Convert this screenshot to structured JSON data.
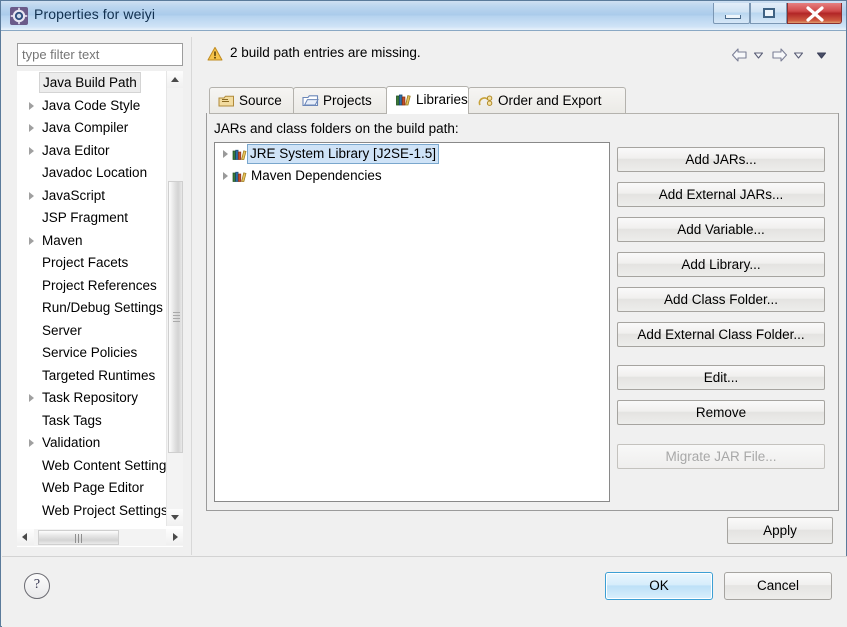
{
  "window": {
    "title": "Properties for weiyi",
    "icon": "eclipse-properties-icon",
    "controls": {
      "minimize": "minimize-button",
      "maximize": "maximize-button",
      "close": "close-button"
    }
  },
  "sidebar": {
    "filter": {
      "placeholder": "type filter text",
      "value": ""
    },
    "items": [
      {
        "label": "Java Build Path",
        "expandable": false,
        "selected": true
      },
      {
        "label": "Java Code Style",
        "expandable": true,
        "selected": false
      },
      {
        "label": "Java Compiler",
        "expandable": true,
        "selected": false
      },
      {
        "label": "Java Editor",
        "expandable": true,
        "selected": false
      },
      {
        "label": "Javadoc Location",
        "expandable": false,
        "selected": false
      },
      {
        "label": "JavaScript",
        "expandable": true,
        "selected": false
      },
      {
        "label": "JSP Fragment",
        "expandable": false,
        "selected": false
      },
      {
        "label": "Maven",
        "expandable": true,
        "selected": false
      },
      {
        "label": "Project Facets",
        "expandable": false,
        "selected": false
      },
      {
        "label": "Project References",
        "expandable": false,
        "selected": false
      },
      {
        "label": "Run/Debug Settings",
        "expandable": false,
        "selected": false
      },
      {
        "label": "Server",
        "expandable": false,
        "selected": false
      },
      {
        "label": "Service Policies",
        "expandable": false,
        "selected": false
      },
      {
        "label": "Targeted Runtimes",
        "expandable": false,
        "selected": false
      },
      {
        "label": "Task Repository",
        "expandable": true,
        "selected": false
      },
      {
        "label": "Task Tags",
        "expandable": false,
        "selected": false
      },
      {
        "label": "Validation",
        "expandable": true,
        "selected": false
      },
      {
        "label": "Web Content Settings",
        "expandable": false,
        "selected": false
      },
      {
        "label": "Web Page Editor",
        "expandable": false,
        "selected": false
      },
      {
        "label": "Web Project Settings",
        "expandable": false,
        "selected": false
      }
    ]
  },
  "status": {
    "icon": "warning-icon",
    "message": "2 build path entries are missing."
  },
  "nav": {
    "back": "back-arrow-icon",
    "back_menu": "back-dropdown-icon",
    "forward": "forward-arrow-icon",
    "forward_menu": "forward-dropdown-icon",
    "menu": "view-menu-icon"
  },
  "tabs": [
    {
      "label": "Source",
      "icon": "source-folder-icon",
      "active": false
    },
    {
      "label": "Projects",
      "icon": "projects-folder-icon",
      "active": false
    },
    {
      "label": "Libraries",
      "icon": "libraries-books-icon",
      "active": true
    },
    {
      "label": "Order and Export",
      "icon": "order-export-icon",
      "active": false
    }
  ],
  "main": {
    "list_label": "JARs and class folders on the build path:",
    "entries": [
      {
        "label": "JRE System Library [J2SE-1.5]",
        "icon": "library-books-icon",
        "selected": true,
        "expandable": true
      },
      {
        "label": "Maven Dependencies",
        "icon": "library-books-icon",
        "selected": false,
        "expandable": true
      }
    ],
    "side_buttons": [
      {
        "label": "Add JARs...",
        "enabled": true
      },
      {
        "label": "Add External JARs...",
        "enabled": true
      },
      {
        "label": "Add Variable...",
        "enabled": true
      },
      {
        "label": "Add Library...",
        "enabled": true
      },
      {
        "label": "Add Class Folder...",
        "enabled": true
      },
      {
        "label": "Add External Class Folder...",
        "enabled": true
      },
      {
        "label": "Edit...",
        "enabled": true
      },
      {
        "label": "Remove",
        "enabled": true
      },
      {
        "label": "Migrate JAR File...",
        "enabled": false
      }
    ],
    "apply_label": "Apply"
  },
  "footer": {
    "help_label": "?",
    "ok_label": "OK",
    "cancel_label": "Cancel"
  },
  "colors": {
    "title_bar": "#aacbeb",
    "close_button": "#b22626",
    "selection": "#cfe3f7",
    "ok_accent": "#3c9fd4",
    "warning": "#f0b429"
  }
}
